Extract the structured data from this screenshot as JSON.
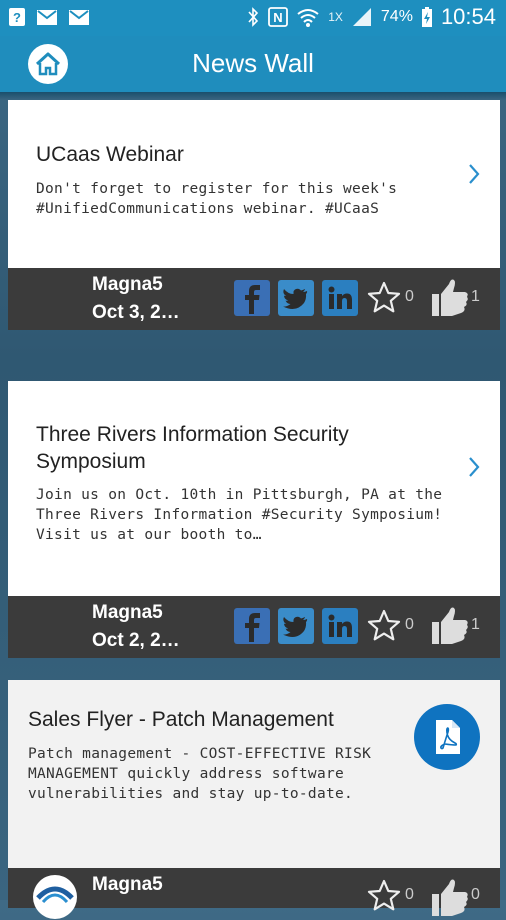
{
  "status_bar": {
    "network": "1X",
    "battery": "74%",
    "time": "10:54"
  },
  "app_bar": {
    "title": "News Wall"
  },
  "posts": [
    {
      "title": "UCaas Webinar",
      "body": "Don't forget to register for this week's #UnifiedCommunications webinar. #UCaaS",
      "author": "Magna5",
      "date": "Oct 3, 2…",
      "star_count": "0",
      "like_count": "1"
    },
    {
      "title": "Three Rivers Information Security Symposium",
      "body": "Join us on Oct. 10th in Pittsburgh, PA at the Three Rivers Information #Security Symposium! Visit us at our booth to…",
      "author": "Magna5",
      "date": "Oct 2, 2…",
      "star_count": "0",
      "like_count": "1"
    },
    {
      "title": "Sales Flyer - Patch Management",
      "body": "Patch management - COST-EFFECTIVE RISK MANAGEMENT quickly address software vulnerabilities and stay up-to-date.",
      "author": "Magna5",
      "star_count": "0",
      "like_count": "0"
    }
  ],
  "icons": {
    "home": "home-icon",
    "chevron": "chevron-right-icon",
    "facebook": "facebook-icon",
    "twitter": "twitter-icon",
    "linkedin": "linkedin-icon",
    "star": "star-outline-icon",
    "like": "thumbs-up-icon",
    "pdf": "pdf-icon"
  },
  "colors": {
    "primary": "#1f8dbd",
    "footer": "#3b3b3b",
    "social_blue": "#3a8cc9",
    "pdf_button": "#0f73c0"
  }
}
